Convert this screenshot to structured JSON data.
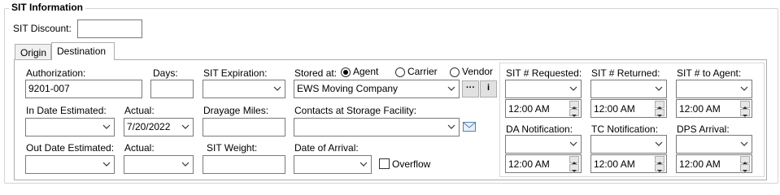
{
  "group": {
    "title": "SIT Information"
  },
  "sit_discount": {
    "label": "SIT Discount:",
    "value": ""
  },
  "tabs": [
    {
      "label": "Origin"
    },
    {
      "label": "Destination"
    }
  ],
  "left": {
    "authorization": {
      "label": "Authorization:",
      "value": "9201-007"
    },
    "days": {
      "label": "Days:",
      "value": ""
    },
    "sit_expiration": {
      "label": "SIT Expiration:",
      "value": ""
    },
    "in_date_estimated": {
      "label": "In Date Estimated:",
      "value": ""
    },
    "in_actual": {
      "label": "Actual:",
      "value": "7/20/2022"
    },
    "drayage_miles": {
      "label": "Drayage Miles:",
      "value": ""
    },
    "out_date_estimated": {
      "label": "Out Date Estimated:",
      "value": ""
    },
    "out_actual": {
      "label": "Actual:",
      "value": ""
    },
    "sit_weight": {
      "label": "SIT Weight:",
      "value": ""
    }
  },
  "storage": {
    "stored_at_label": "Stored at:",
    "options": [
      {
        "label": "Agent",
        "checked": true
      },
      {
        "label": "Carrier",
        "checked": false
      },
      {
        "label": "Vendor",
        "checked": false
      }
    ],
    "company": "EWS Moving Company",
    "ellipsis": "···",
    "info": "i",
    "contacts_label": "Contacts at Storage Facility:",
    "contacts_value": "",
    "date_of_arrival_label": "Date of Arrival:",
    "date_of_arrival_value": "",
    "overflow_label": "Overflow"
  },
  "right": {
    "sit_requested": {
      "label": "SIT # Requested:",
      "date": "",
      "time": "12:00 AM"
    },
    "sit_returned": {
      "label": "SIT # Returned:",
      "date": "",
      "time": "12:00 AM"
    },
    "sit_to_agent": {
      "label": "SIT # to Agent:",
      "date": "",
      "time": "12:00 AM"
    },
    "da_notification": {
      "label": "DA Notification:",
      "date": "",
      "time": "12:00 AM"
    },
    "tc_notification": {
      "label": "TC Notification:",
      "date": "",
      "time": "12:00 AM"
    },
    "dps_arrival": {
      "label": "DPS Arrival:",
      "date": "",
      "time": "12:00 AM"
    }
  },
  "icons": {
    "mail": "mail-icon",
    "chevron": "chevron-down-icon",
    "spin_up": "spin-up-icon",
    "spin_down": "spin-down-icon"
  }
}
